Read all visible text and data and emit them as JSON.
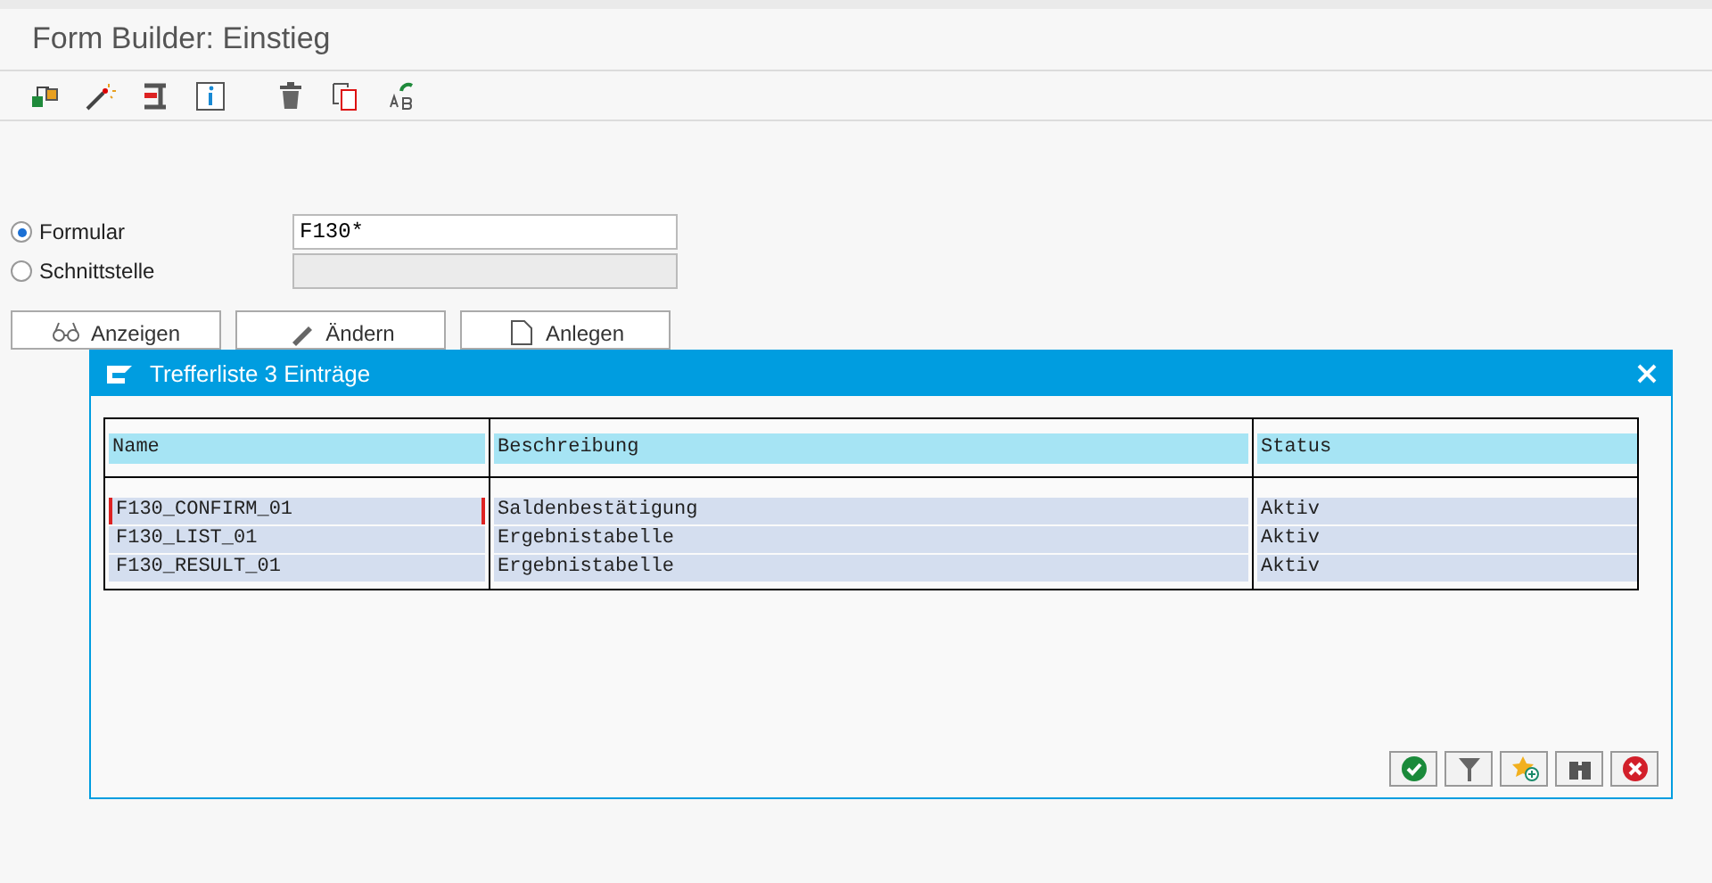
{
  "window": {
    "title": "Form Builder: Einstieg"
  },
  "toolbar": [
    {
      "kind": "hierarchy"
    },
    {
      "kind": "wand"
    },
    {
      "kind": "clamp"
    },
    {
      "kind": "info"
    },
    {
      "kind": "trash"
    },
    {
      "kind": "copy"
    },
    {
      "kind": "rename"
    }
  ],
  "options": [
    {
      "label": "Formular",
      "selected": true,
      "value": "F130*",
      "disabled": false
    },
    {
      "label": "Schnittstelle",
      "selected": false,
      "disabled": true
    }
  ],
  "buttons": [
    {
      "label": "Anzeigen",
      "kind": "glasses"
    },
    {
      "label": "Ändern",
      "kind": "pencil"
    },
    {
      "label": "Anlegen",
      "kind": "page"
    }
  ],
  "dialog": {
    "title": "Trefferliste 3 Einträge",
    "table": {
      "columns": [
        "Name",
        "Beschreibung",
        "Status"
      ],
      "rows": [
        {
          "cells": [
            "F130_CONFIRM_01",
            "Saldenbestätigung",
            "Aktiv"
          ],
          "focused": true
        },
        {
          "cells": [
            "F130_LIST_01",
            "Ergebnistabelle",
            "Aktiv"
          ],
          "focused": false
        },
        {
          "cells": [
            "F130_RESULT_01",
            "Ergebnistabelle",
            "Aktiv"
          ],
          "focused": false
        }
      ]
    },
    "buttons": [
      {
        "kind": "confirm"
      },
      {
        "kind": "filter"
      },
      {
        "kind": "favorite"
      },
      {
        "kind": "find"
      },
      {
        "kind": "cancel"
      }
    ]
  }
}
